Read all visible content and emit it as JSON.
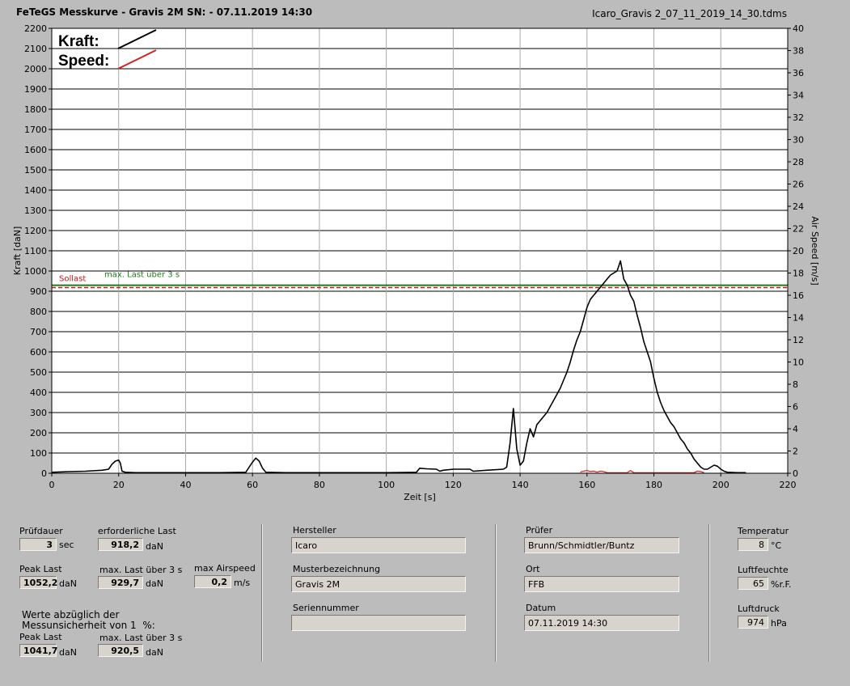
{
  "header": {
    "title": "FeTeGS Messkurve - Gravis 2M  SN:  - 07.11.2019 14:30",
    "file": "Icaro_Gravis 2_07_11_2019_14_30.tdms"
  },
  "chart_data": {
    "type": "line",
    "xlabel": "Zeit [s]",
    "ylabel": "Kraft [daN]",
    "y2label": "Air Speed [m/s]",
    "xlim": [
      0,
      220
    ],
    "ylim": [
      0,
      2200
    ],
    "y2lim": [
      0,
      40
    ],
    "x_ticks": [
      "0",
      "20",
      "40",
      "60",
      "80",
      "100",
      "120",
      "140",
      "160",
      "180",
      "200",
      "220"
    ],
    "y_ticks": [
      "0",
      "100",
      "200",
      "300",
      "400",
      "500",
      "600",
      "700",
      "800",
      "900",
      "1000",
      "1100",
      "1200",
      "1300",
      "1400",
      "1500",
      "1600",
      "1700",
      "1800",
      "1900",
      "2000",
      "2100",
      "2200"
    ],
    "y2_ticks": [
      "0",
      "2",
      "4",
      "6",
      "8",
      "10",
      "12",
      "14",
      "16",
      "18",
      "20",
      "22",
      "24",
      "26",
      "28",
      "30",
      "32",
      "34",
      "36",
      "38",
      "40"
    ],
    "grid": true,
    "legend": {
      "position": "top-left",
      "kraft_label": "Kraft:",
      "speed_label": "Speed:"
    },
    "reference_lines": {
      "sollast_label": "Sollast",
      "sollast_value": 918.2,
      "maxlast_label": "max. Last über  3 s",
      "maxlast_value": 929.7
    },
    "series": [
      {
        "name": "Kraft:",
        "color": "#000000",
        "x": [
          0,
          5,
          10,
          15,
          17,
          18,
          19,
          20,
          20.5,
          21,
          22,
          25,
          30,
          40,
          50,
          58,
          59,
          60,
          61,
          62,
          63,
          64,
          70,
          80,
          90,
          100,
          109,
          110,
          112,
          115,
          116,
          117,
          120,
          125,
          126,
          130,
          135,
          136,
          137,
          138,
          139,
          140,
          141,
          142,
          143,
          144,
          145,
          146,
          147,
          148,
          150,
          152,
          154,
          155,
          156,
          157,
          158,
          159,
          160,
          161,
          162,
          163,
          164,
          165,
          166,
          167,
          168,
          169,
          170,
          171,
          172,
          173,
          174,
          175,
          176,
          177,
          178,
          179,
          180,
          181,
          182,
          183,
          184,
          185,
          186,
          187,
          188,
          189,
          190,
          191,
          192,
          193,
          194,
          195,
          196,
          197,
          198,
          199,
          200,
          201,
          202,
          205,
          207.5
        ],
        "y": [
          5,
          8,
          10,
          15,
          20,
          45,
          60,
          65,
          50,
          10,
          5,
          3,
          3,
          3,
          3,
          5,
          30,
          55,
          75,
          60,
          25,
          5,
          3,
          3,
          3,
          3,
          5,
          25,
          22,
          20,
          10,
          15,
          20,
          20,
          10,
          15,
          20,
          30,
          150,
          320,
          120,
          40,
          60,
          150,
          220,
          180,
          240,
          260,
          280,
          300,
          360,
          420,
          500,
          550,
          610,
          660,
          700,
          760,
          820,
          860,
          880,
          900,
          920,
          940,
          960,
          980,
          990,
          1000,
          1050,
          960,
          930,
          880,
          850,
          780,
          720,
          650,
          600,
          550,
          470,
          400,
          350,
          310,
          280,
          250,
          230,
          200,
          170,
          150,
          120,
          100,
          70,
          50,
          30,
          20,
          20,
          30,
          40,
          35,
          20,
          10,
          5,
          3,
          3
        ]
      },
      {
        "name": "Speed:",
        "color": "#d42020",
        "x": [
          158,
          159,
          160,
          161,
          162,
          163,
          164,
          165,
          166,
          172,
          173,
          174,
          192,
          193,
          194,
          195
        ],
        "y": [
          0.1,
          0.2,
          0.25,
          0.15,
          0.2,
          0.1,
          0.2,
          0.15,
          0.05,
          0.05,
          0.25,
          0.05,
          0.05,
          0.2,
          0.15,
          0.05
        ]
      }
    ]
  },
  "panel": {
    "pruefdauer": {
      "label": "Prüfdauer",
      "value": "3",
      "unit": "sec"
    },
    "erf_last": {
      "label": "erforderliche Last",
      "value": "918,2",
      "unit": "daN"
    },
    "peak_last": {
      "label": "Peak Last",
      "value": "1052,2",
      "unit": "daN"
    },
    "max_last": {
      "label": "max. Last über  3 s",
      "value": "929,7",
      "unit": "daN"
    },
    "max_airspeed": {
      "label": "max Airspeed",
      "value": "0,2",
      "unit": "m/s"
    },
    "werte_note": "Werte abzüglich der\nMessunsicherheit von 1  %:",
    "peak_last2": {
      "label": "Peak Last",
      "value": "1041,7",
      "unit": "daN"
    },
    "max_last2": {
      "label": "max. Last über  3 s",
      "value": "920,5",
      "unit": "daN"
    },
    "hersteller": {
      "label": "Hersteller",
      "value": "Icaro"
    },
    "muster": {
      "label": "Musterbezeichnung",
      "value": "Gravis 2M"
    },
    "serien": {
      "label": "Seriennummer",
      "value": ""
    },
    "pruefer": {
      "label": "Prüfer",
      "value": "Brunn/Schmidtler/Buntz"
    },
    "ort": {
      "label": "Ort",
      "value": "FFB"
    },
    "datum": {
      "label": "Datum",
      "value": "07.11.2019 14:30"
    },
    "temperatur": {
      "label": "Temperatur",
      "value": "8",
      "unit": "°C"
    },
    "luftfeuchte": {
      "label": "Luftfeuchte",
      "value": "65",
      "unit": "%r.F."
    },
    "luftdruck": {
      "label": "Luftdruck",
      "value": "974",
      "unit": "hPa"
    }
  }
}
